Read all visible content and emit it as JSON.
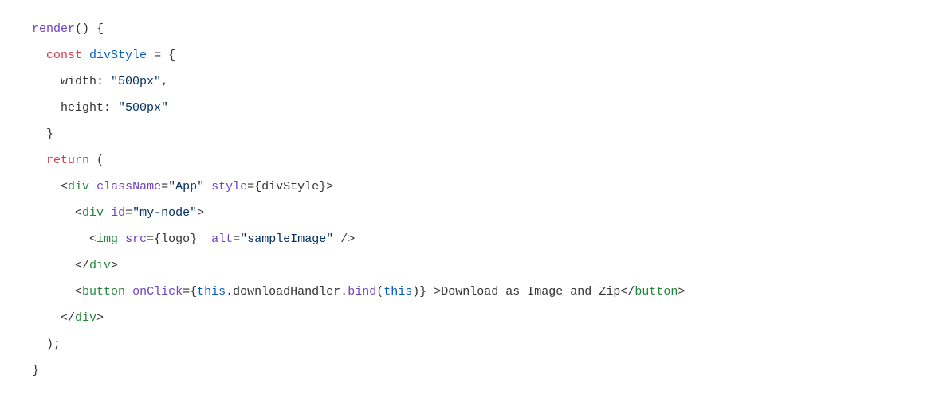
{
  "code": {
    "l1": {
      "fn": "render",
      "rest": "() {"
    },
    "l2": {
      "kw": "const",
      "var": "divStyle",
      "rest": " = {"
    },
    "l3": {
      "key": "width",
      "colon": ": ",
      "val": "\"500px\"",
      "comma": ","
    },
    "l4": {
      "key": "height",
      "colon": ": ",
      "val": "\"500px\""
    },
    "l5": {
      "brace": "}"
    },
    "l6": {
      "kw": "return",
      "paren": " ("
    },
    "l7": {
      "open": "<",
      "tag": "div",
      "sp": " ",
      "a1": "className",
      "eq1": "=",
      "v1": "\"App\"",
      "a2": "style",
      "eq2": "=",
      "v2_open": "{",
      "v2_var": "divStyle",
      "v2_close": "}",
      "close": ">"
    },
    "l8": {
      "open": "<",
      "tag": "div",
      "sp": " ",
      "a1": "id",
      "eq1": "=",
      "v1": "\"my-node\"",
      "close": ">"
    },
    "l9": {
      "open": "<",
      "tag": "img",
      "sp": " ",
      "a1": "src",
      "eq1": "=",
      "v1_open": "{",
      "v1_var": "logo",
      "v1_close": "}",
      "sp2": "  ",
      "a2": "alt",
      "eq2": "=",
      "v2": "\"sampleImage\"",
      "close": " />"
    },
    "l10": {
      "open": "</",
      "tag": "div",
      "close": ">"
    },
    "l11": {
      "open": "<",
      "tag": "button",
      "sp": " ",
      "a1": "onClick",
      "eq1": "=",
      "brace_o": "{",
      "this1": "this",
      "dot1": ".",
      "h": "downloadHandler",
      "dot2": ".",
      "bind": "bind",
      "paren_o": "(",
      "this2": "this",
      "paren_c": ")",
      "brace_c": "}",
      "gt": " >",
      "text": "Download as Image and Zip",
      "open2": "</",
      "tag2": "button",
      "close2": ">"
    },
    "l12": {
      "open": "</",
      "tag": "div",
      "close": ">"
    },
    "l13": {
      "paren": ");"
    },
    "l14": {
      "brace": "}"
    }
  }
}
